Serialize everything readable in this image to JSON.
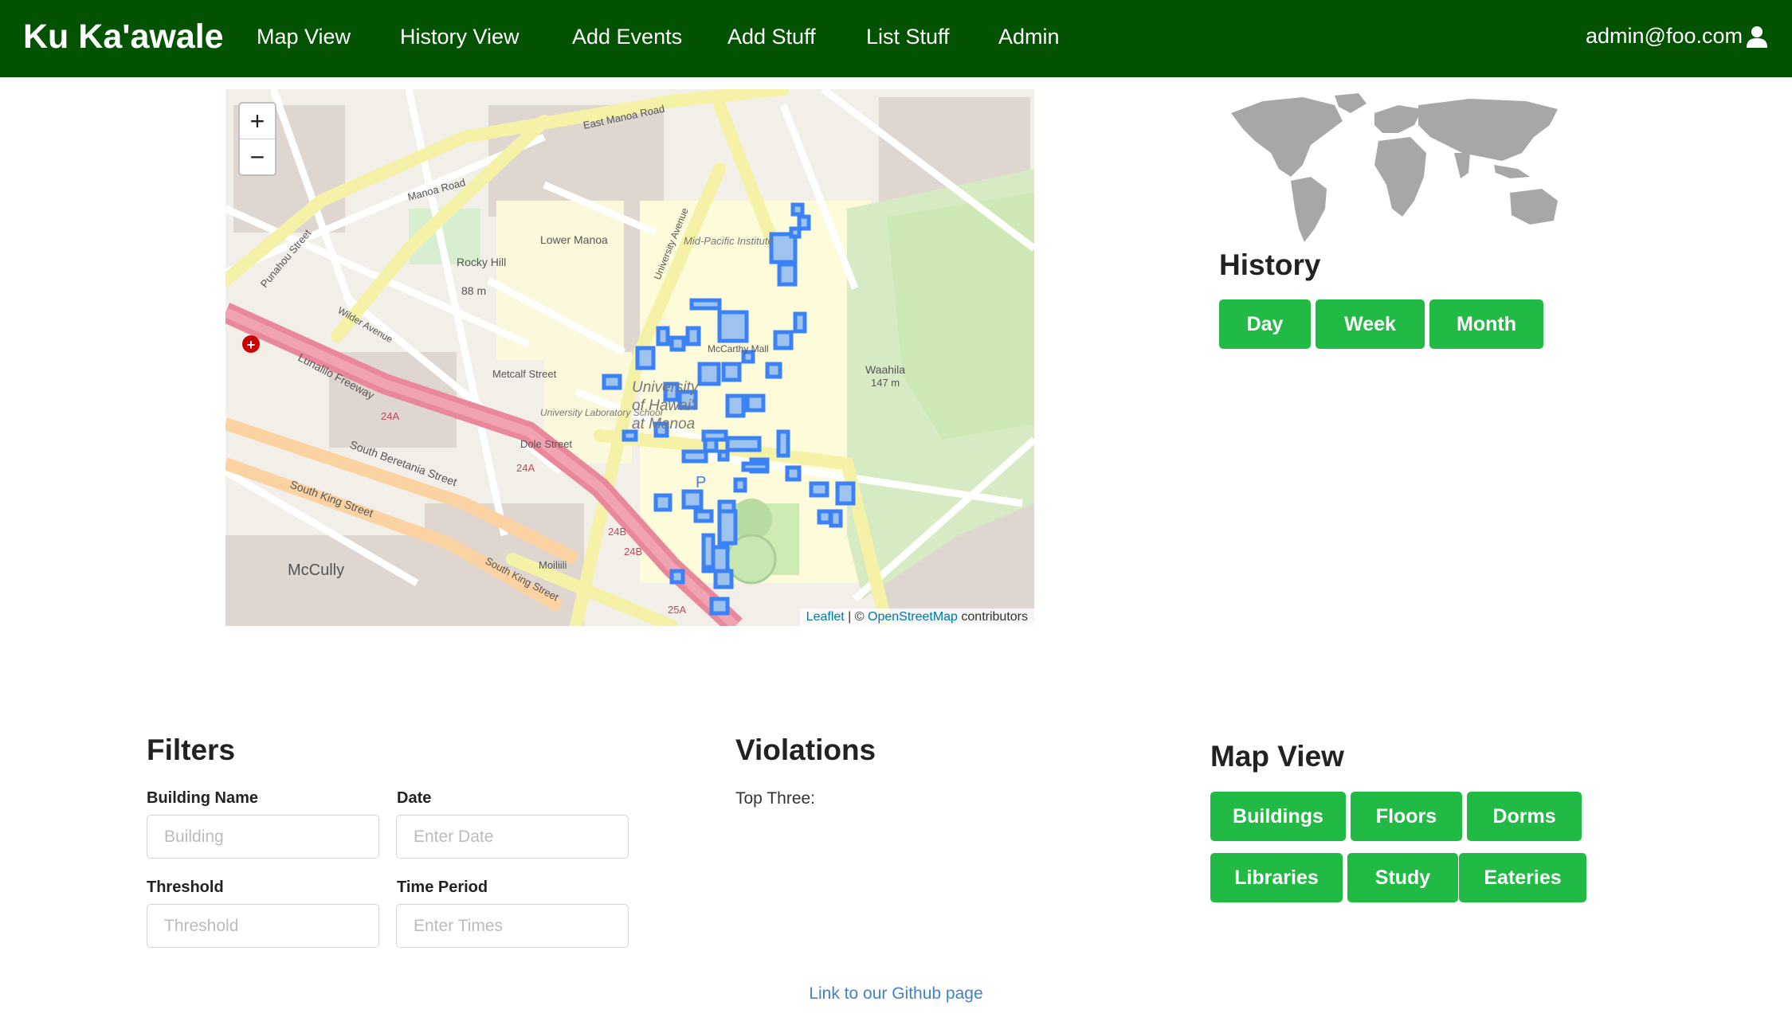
{
  "nav": {
    "brand": "Ku Ka'awale",
    "links": [
      "Map View",
      "History View",
      "Add Events",
      "Add Stuff",
      "List Stuff",
      "Admin"
    ],
    "user": "admin@foo.com",
    "user_icon": "user-icon",
    "bg_color": "#025202"
  },
  "map": {
    "zoom_in": "+",
    "zoom_out": "−",
    "attribution": {
      "leaflet": "Leaflet",
      "sep": " | © ",
      "osm": "OpenStreetMap",
      "suffix": " contributors"
    },
    "labels": {
      "rocky_hill": "Rocky Hill",
      "rocky_hill_elev": "88 m",
      "waahila": "Waahila",
      "waahila_elev": "147 m",
      "mccully": "McCully",
      "lower_manoa": "Lower Manoa",
      "univ1": "University",
      "univ2": "of Hawai'i",
      "univ3": "at Manoa",
      "mid_pacific": "Mid-Pacific Institute",
      "mccarthy": "McCarthy Mall",
      "moiliili": "Moiliili",
      "lunalilo": "Lunalilo Freeway",
      "dole": "Dole Street",
      "metcalf": "Metcalf Street",
      "university_ave": "University Avenue",
      "s_beretania": "South Beretania Street",
      "s_king": "South King Street",
      "king2": "South King Street",
      "punahou": "Punahou Street",
      "manoa_rd": "Manoa Road",
      "east_manoa": "East Manoa Road",
      "wilder": "Wilder Avenue",
      "lab_school": "University Laboratory School",
      "p": "P",
      "x24a": "24A",
      "x24a2": "24A",
      "x24b": "24B",
      "x24b2": "24B",
      "x25a": "25A"
    },
    "colors": {
      "building_outline": "#3b82f6",
      "freeway": "#e9889a",
      "major_road": "#f7fabf",
      "park": "#cdebb0"
    }
  },
  "history": {
    "title": "History",
    "buttons": [
      "Day",
      "Week",
      "Month"
    ]
  },
  "filters": {
    "title": "Filters",
    "fields": [
      {
        "label": "Building Name",
        "placeholder": "Building"
      },
      {
        "label": "Date",
        "placeholder": "Enter Date"
      },
      {
        "label": "Threshold",
        "placeholder": "Threshold"
      },
      {
        "label": "Time Period",
        "placeholder": "Enter Times"
      }
    ]
  },
  "violations": {
    "title": "Violations",
    "subtitle": "Top Three:"
  },
  "map_view": {
    "title": "Map View",
    "buttons": [
      "Buildings",
      "Floors",
      "Dorms",
      "Libraries",
      "Study",
      "Eateries"
    ]
  },
  "footer": {
    "link": "Link to our Github page"
  },
  "accent_color": "#21ba45"
}
